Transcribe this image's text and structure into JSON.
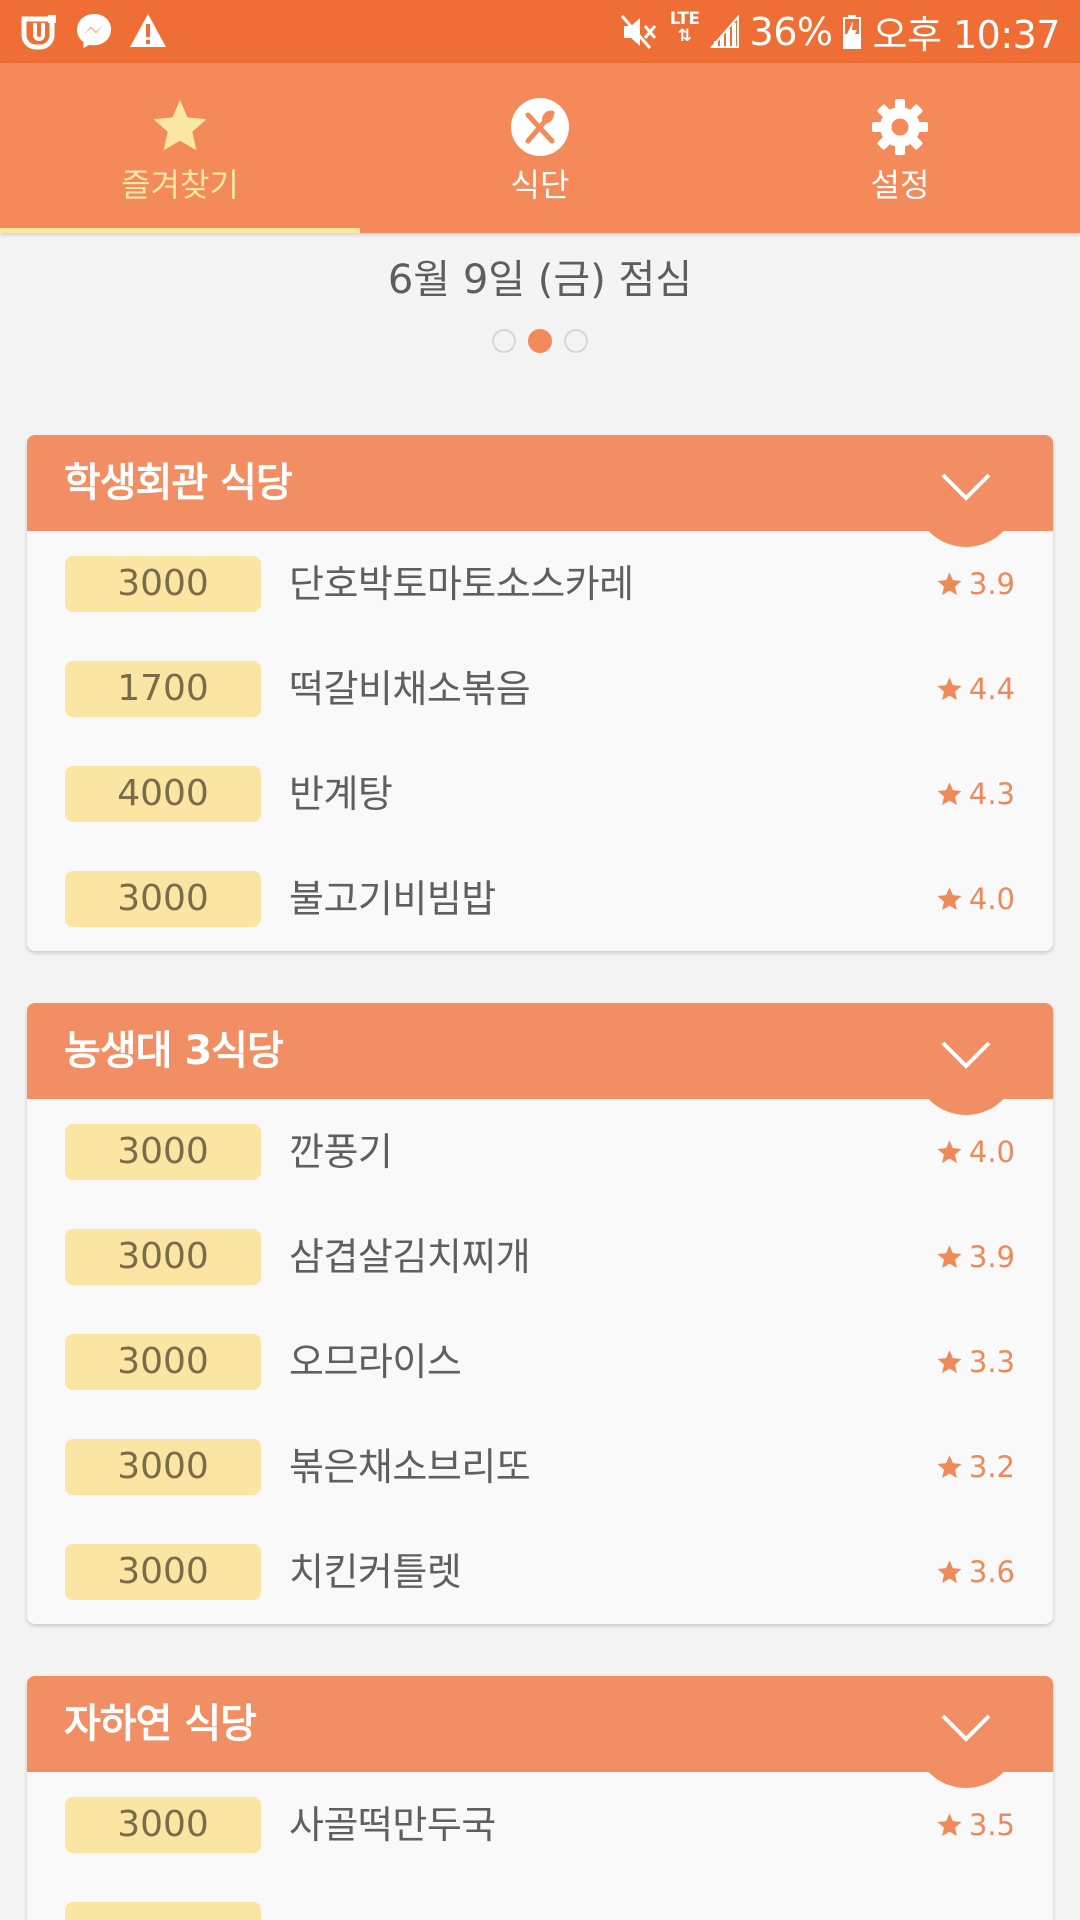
{
  "status_bar": {
    "battery": "36%",
    "network": "LTE",
    "time": "오후 10:37",
    "left_icons": [
      "uplus-icon",
      "messenger-icon",
      "warning-icon"
    ],
    "right_icons": [
      "mute-icon",
      "lte-icon",
      "signal-icon",
      "battery-charging-icon"
    ]
  },
  "tabs": [
    {
      "label": "즐겨찾기",
      "icon": "star-icon",
      "active": true
    },
    {
      "label": "식단",
      "icon": "fork-knife-icon",
      "active": false
    },
    {
      "label": "설정",
      "icon": "gear-icon",
      "active": false
    }
  ],
  "date_title": "6월 9일 (금) 점심",
  "page_indicator": {
    "count": 3,
    "active_index": 1
  },
  "restaurants": [
    {
      "name": "학생회관 식당",
      "menus": [
        {
          "price": "3000",
          "name": "단호박토마토소스카레",
          "rating": "3.9"
        },
        {
          "price": "1700",
          "name": "떡갈비채소볶음",
          "rating": "4.4"
        },
        {
          "price": "4000",
          "name": "반계탕",
          "rating": "4.3"
        },
        {
          "price": "3000",
          "name": "불고기비빔밥",
          "rating": "4.0"
        }
      ]
    },
    {
      "name": "농생대 3식당",
      "menus": [
        {
          "price": "3000",
          "name": "깐풍기",
          "rating": "4.0"
        },
        {
          "price": "3000",
          "name": "삼겹살김치찌개",
          "rating": "3.9"
        },
        {
          "price": "3000",
          "name": "오므라이스",
          "rating": "3.3"
        },
        {
          "price": "3000",
          "name": "볶은채소브리또",
          "rating": "3.2"
        },
        {
          "price": "3000",
          "name": "치킨커틀렛",
          "rating": "3.6"
        }
      ]
    },
    {
      "name": "자하연 식당",
      "menus": [
        {
          "price": "3000",
          "name": "사골떡만두국",
          "rating": "3.5"
        }
      ]
    }
  ],
  "colors": {
    "status_bar": "#ee6e35",
    "tab_bar": "#f4895a",
    "active_tab": "#fbe7a4",
    "card_header": "#f28e63",
    "price_badge": "#fae6a2",
    "rating": "#ee8a5a"
  }
}
